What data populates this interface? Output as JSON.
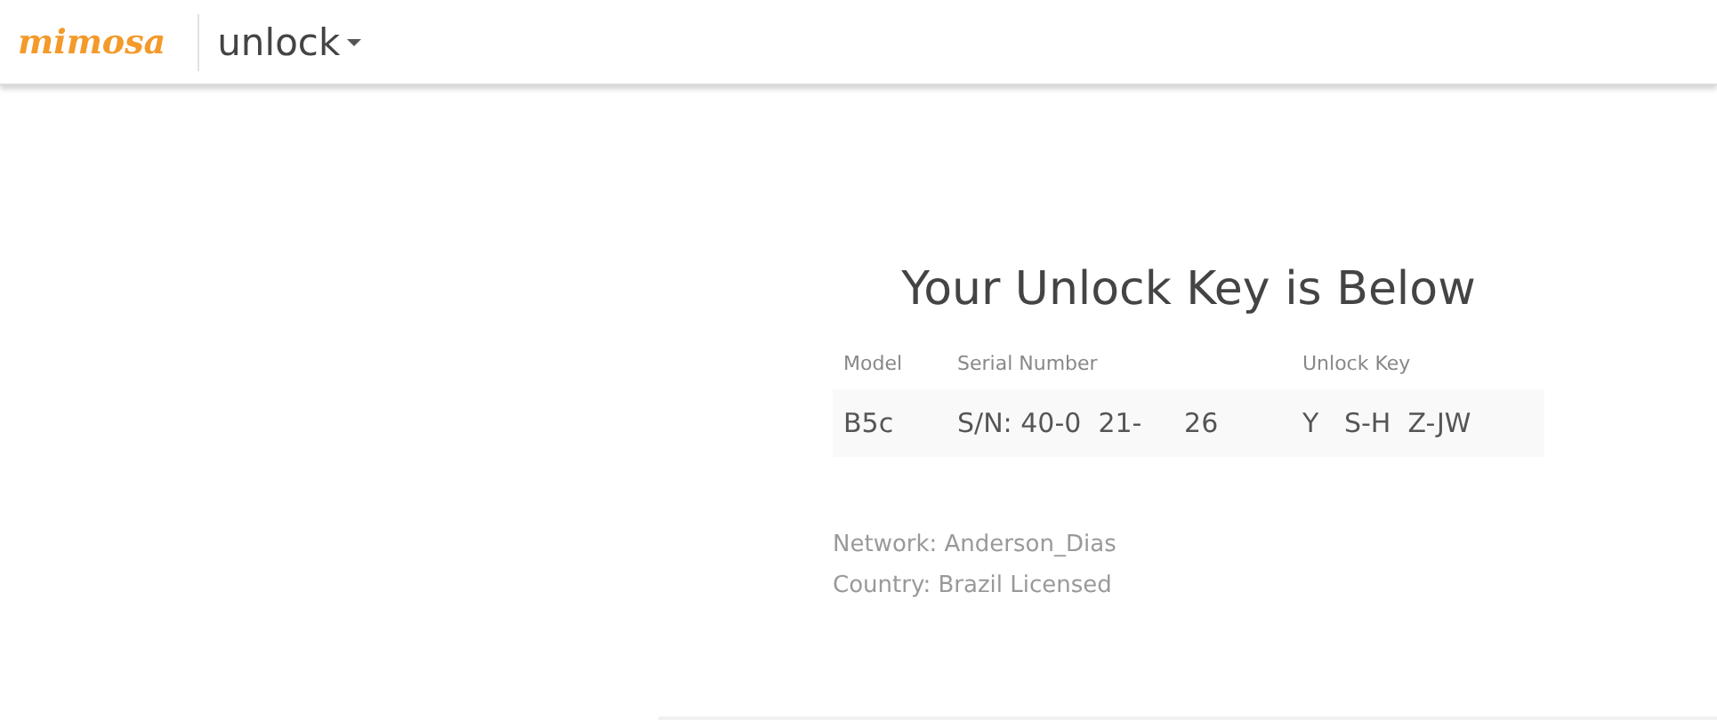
{
  "header": {
    "logo": "mimosa",
    "menu": "unlock"
  },
  "title": "Your Unlock Key is Below",
  "table": {
    "columns": [
      "Model",
      "Serial Number",
      "Unlock Key"
    ],
    "rows": [
      [
        "B5c",
        "S/N: 40-0  21-     26",
        "Y   S-H  Z-JW"
      ]
    ]
  },
  "info": [
    "Network: Anderson_Dias",
    "Country: Brazil Licensed"
  ]
}
